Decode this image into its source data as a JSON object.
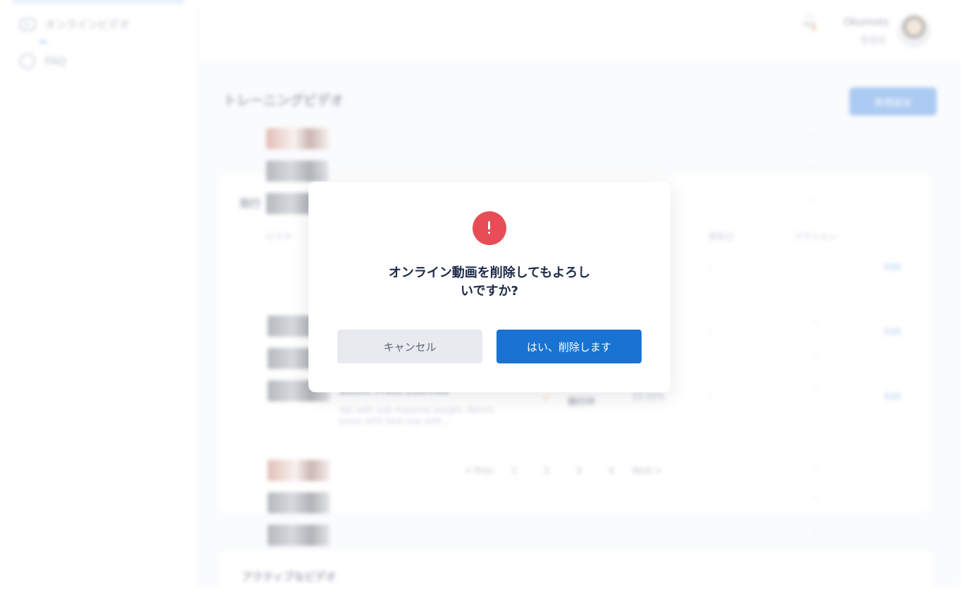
{
  "sidebar": {
    "items": [
      {
        "label": "オンラインビデオ",
        "icon": "video-icon"
      },
      {
        "label": "FAQ",
        "icon": "faq-icon"
      }
    ]
  },
  "header": {
    "user_name": "Okumoto",
    "user_role": "管理者"
  },
  "page": {
    "title": "トレーニングビデオ",
    "new_button": "新規追加"
  },
  "sections": {
    "published_title": "発行",
    "active_title": "アクティブなビデオ",
    "columns": [
      "ビデオ",
      "更新日",
      "アクション"
    ]
  },
  "rows": [
    {
      "title": "Bench Press Exercise",
      "desc": "Set with sub maximal weight. Bench press with Seal row with...",
      "status": "発行中",
      "date": "15.35%",
      "action": "Edit",
      "dash": "-"
    }
  ],
  "pagination": [
    "< Prev",
    "1",
    "2",
    "3",
    "4",
    "Next >"
  ],
  "edit_label": "Edit",
  "dash": "-",
  "modal": {
    "message": "オンライン動画を削除してもよろしいですか?",
    "cancel_label": "キャンセル",
    "confirm_label": "はい、削除します",
    "icon": "exclamation-icon",
    "icon_color": "#e84d57",
    "confirm_color": "#1873d3"
  }
}
